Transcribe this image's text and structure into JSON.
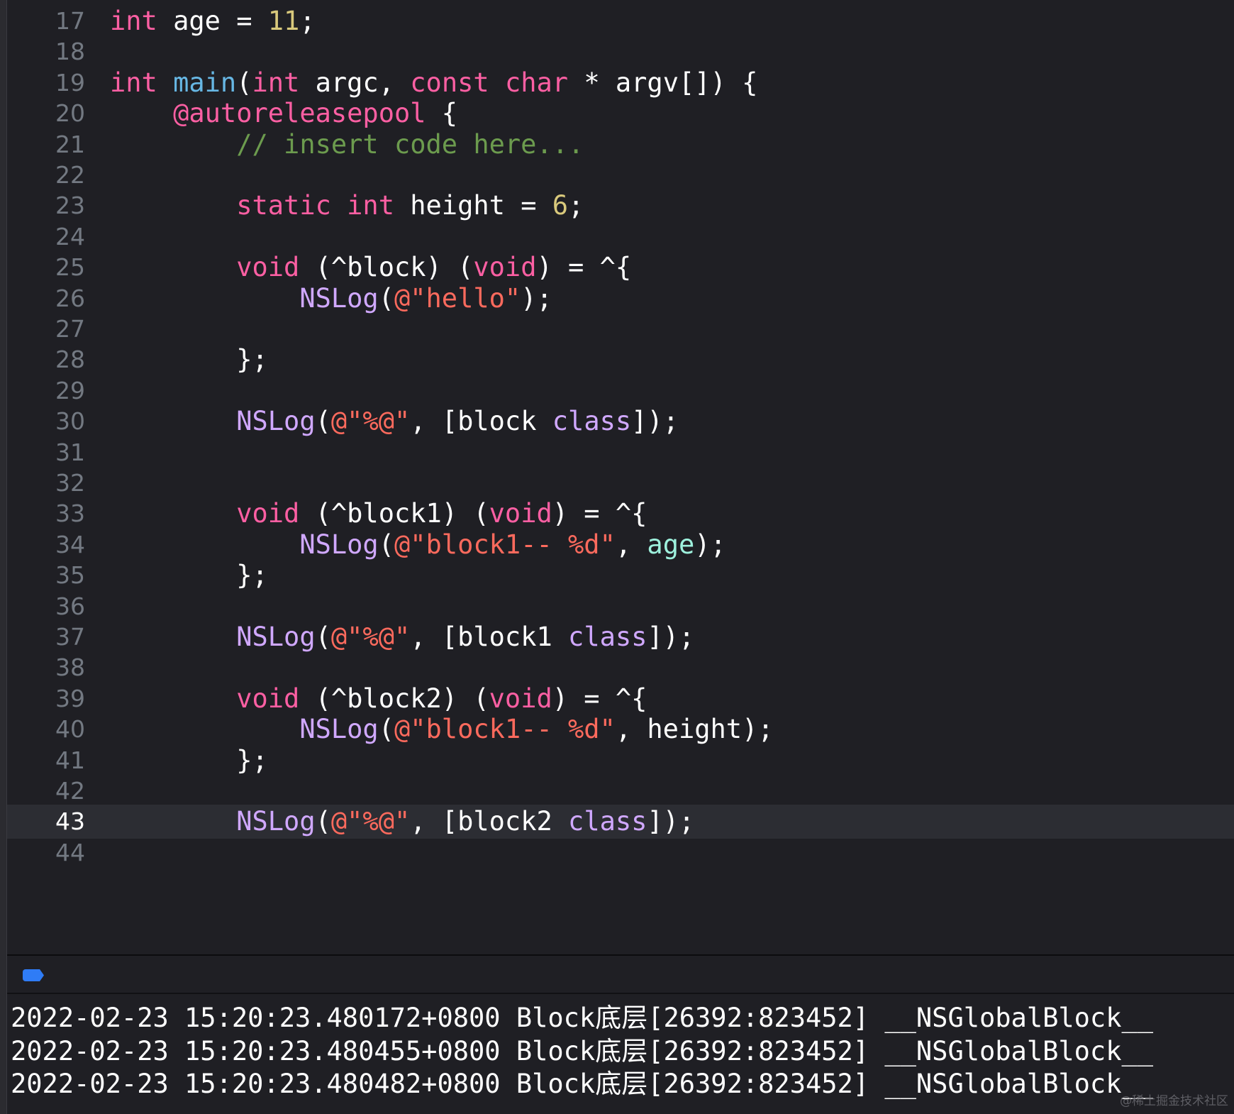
{
  "colors": {
    "keyword": "#fc5fa3",
    "function": "#67b7e4",
    "class_method": "#d0a8ff",
    "number": "#d9c97c",
    "string": "#fc6a5d",
    "comment": "#6c9b4e",
    "identifier": "#9ef1dd",
    "plain": "#ffffff",
    "background": "#1f1f24",
    "current_line": "#2c2d33",
    "accent_blue": "#2f7cf6"
  },
  "editor": {
    "current_line": "43",
    "lines": [
      {
        "n": "17",
        "tokens": [
          [
            "kw",
            "int"
          ],
          [
            "pl",
            " age = "
          ],
          [
            "num",
            "11"
          ],
          [
            "pl",
            ";"
          ]
        ]
      },
      {
        "n": "18",
        "tokens": []
      },
      {
        "n": "19",
        "tokens": [
          [
            "kw",
            "int"
          ],
          [
            "pl",
            " "
          ],
          [
            "fn",
            "main"
          ],
          [
            "pl",
            "("
          ],
          [
            "kw",
            "int"
          ],
          [
            "pl",
            " argc, "
          ],
          [
            "kw",
            "const"
          ],
          [
            "pl",
            " "
          ],
          [
            "kw",
            "char"
          ],
          [
            "pl",
            " * argv[]) {"
          ]
        ]
      },
      {
        "n": "20",
        "tokens": [
          [
            "pl",
            "    "
          ],
          [
            "kw",
            "@autoreleasepool"
          ],
          [
            "pl",
            " {"
          ]
        ]
      },
      {
        "n": "21",
        "tokens": [
          [
            "pl",
            "        "
          ],
          [
            "cmt",
            "// insert code here..."
          ]
        ]
      },
      {
        "n": "22",
        "tokens": []
      },
      {
        "n": "23",
        "tokens": [
          [
            "pl",
            "        "
          ],
          [
            "kw",
            "static"
          ],
          [
            "pl",
            " "
          ],
          [
            "kw",
            "int"
          ],
          [
            "pl",
            " height = "
          ],
          [
            "num",
            "6"
          ],
          [
            "pl",
            ";"
          ]
        ]
      },
      {
        "n": "24",
        "tokens": []
      },
      {
        "n": "25",
        "tokens": [
          [
            "pl",
            "        "
          ],
          [
            "kw",
            "void"
          ],
          [
            "pl",
            " (^block) ("
          ],
          [
            "kw",
            "void"
          ],
          [
            "pl",
            ") = ^{"
          ]
        ]
      },
      {
        "n": "26",
        "tokens": [
          [
            "pl",
            "            "
          ],
          [
            "cls",
            "NSLog"
          ],
          [
            "pl",
            "("
          ],
          [
            "str",
            "@\"hello\""
          ],
          [
            "pl",
            ");"
          ]
        ]
      },
      {
        "n": "27",
        "tokens": []
      },
      {
        "n": "28",
        "tokens": [
          [
            "pl",
            "        };"
          ]
        ]
      },
      {
        "n": "29",
        "tokens": []
      },
      {
        "n": "30",
        "tokens": [
          [
            "pl",
            "        "
          ],
          [
            "cls",
            "NSLog"
          ],
          [
            "pl",
            "("
          ],
          [
            "str",
            "@\"%@\""
          ],
          [
            "pl",
            ", [block "
          ],
          [
            "cls",
            "class"
          ],
          [
            "pl",
            "]);"
          ]
        ]
      },
      {
        "n": "31",
        "tokens": []
      },
      {
        "n": "32",
        "tokens": []
      },
      {
        "n": "33",
        "tokens": [
          [
            "pl",
            "        "
          ],
          [
            "kw",
            "void"
          ],
          [
            "pl",
            " (^block1) ("
          ],
          [
            "kw",
            "void"
          ],
          [
            "pl",
            ") = ^{"
          ]
        ]
      },
      {
        "n": "34",
        "tokens": [
          [
            "pl",
            "            "
          ],
          [
            "cls",
            "NSLog"
          ],
          [
            "pl",
            "("
          ],
          [
            "str",
            "@\"block1-- %d\""
          ],
          [
            "pl",
            ", "
          ],
          [
            "id",
            "age"
          ],
          [
            "pl",
            ");"
          ]
        ]
      },
      {
        "n": "35",
        "tokens": [
          [
            "pl",
            "        };"
          ]
        ]
      },
      {
        "n": "36",
        "tokens": []
      },
      {
        "n": "37",
        "tokens": [
          [
            "pl",
            "        "
          ],
          [
            "cls",
            "NSLog"
          ],
          [
            "pl",
            "("
          ],
          [
            "str",
            "@\"%@\""
          ],
          [
            "pl",
            ", [block1 "
          ],
          [
            "cls",
            "class"
          ],
          [
            "pl",
            "]);"
          ]
        ]
      },
      {
        "n": "38",
        "tokens": []
      },
      {
        "n": "39",
        "tokens": [
          [
            "pl",
            "        "
          ],
          [
            "kw",
            "void"
          ],
          [
            "pl",
            " (^block2) ("
          ],
          [
            "kw",
            "void"
          ],
          [
            "pl",
            ") = ^{"
          ]
        ]
      },
      {
        "n": "40",
        "tokens": [
          [
            "pl",
            "            "
          ],
          [
            "cls",
            "NSLog"
          ],
          [
            "pl",
            "("
          ],
          [
            "str",
            "@\"block1-- %d\""
          ],
          [
            "pl",
            ", height);"
          ]
        ]
      },
      {
        "n": "41",
        "tokens": [
          [
            "pl",
            "        };"
          ]
        ]
      },
      {
        "n": "42",
        "tokens": []
      },
      {
        "n": "43",
        "tokens": [
          [
            "pl",
            "        "
          ],
          [
            "cls",
            "NSLog"
          ],
          [
            "pl",
            "("
          ],
          [
            "str",
            "@\"%@\""
          ],
          [
            "pl",
            ", [block2 "
          ],
          [
            "cls",
            "class"
          ],
          [
            "pl",
            "]);"
          ]
        ]
      },
      {
        "n": "44",
        "tokens": []
      }
    ]
  },
  "console": {
    "lines": [
      "2022-02-23 15:20:23.480172+0800 Block底层[26392:823452] __NSGlobalBlock__",
      "2022-02-23 15:20:23.480455+0800 Block底层[26392:823452] __NSGlobalBlock__",
      "2022-02-23 15:20:23.480482+0800 Block底层[26392:823452] __NSGlobalBlock__"
    ]
  },
  "watermark": "@稀土掘金技术社区"
}
